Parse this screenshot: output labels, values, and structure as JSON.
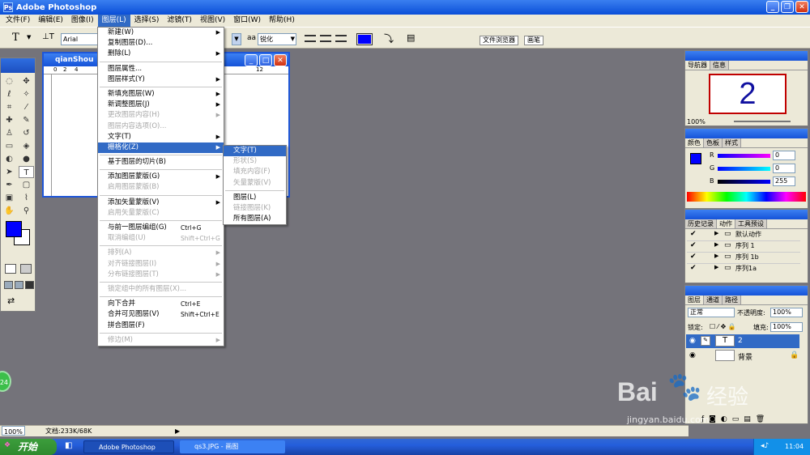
{
  "window": {
    "title": "Adobe Photoshop"
  },
  "menubar": [
    "文件(F)",
    "编辑(E)",
    "图像(I)",
    "图层(L)",
    "选择(S)",
    "滤镜(T)",
    "视图(V)",
    "窗口(W)",
    "帮助(H)"
  ],
  "options_bar": {
    "tool_glyph": "T",
    "font_family": "Arial",
    "aa_label": "aa",
    "antialias": "锐化",
    "tab_file_browser": "文件浏览器",
    "tab_brushes": "画笔"
  },
  "document": {
    "title": "qianShou",
    "ruler_labels": [
      "0",
      "2",
      "4",
      "12"
    ]
  },
  "layer_menu": {
    "items": [
      {
        "label": "新建(W)",
        "sub": true
      },
      {
        "label": "复制图层(D)..."
      },
      {
        "label": "删除(L)",
        "sub": true
      },
      {
        "sep": true
      },
      {
        "label": "图层属性..."
      },
      {
        "label": "图层样式(Y)",
        "sub": true
      },
      {
        "sep": true
      },
      {
        "label": "新填充图层(W)",
        "sub": true
      },
      {
        "label": "新调整图层(J)",
        "sub": true
      },
      {
        "label": "更改图层内容(H)",
        "sub": true,
        "dis": true
      },
      {
        "label": "图层内容选项(O)...",
        "dis": true
      },
      {
        "label": "文字(T)",
        "sub": true
      },
      {
        "label": "栅格化(Z)",
        "sub": true,
        "hi": true
      },
      {
        "sep": true
      },
      {
        "label": "基于图层的切片(B)"
      },
      {
        "sep": true
      },
      {
        "label": "添加图层蒙版(G)",
        "sub": true
      },
      {
        "label": "启用图层蒙版(B)",
        "dis": true
      },
      {
        "sep": true
      },
      {
        "label": "添加矢量蒙版(V)",
        "sub": true
      },
      {
        "label": "启用矢量蒙版(C)",
        "dis": true
      },
      {
        "sep": true
      },
      {
        "label": "与前一图层编组(G)",
        "shortcut": "Ctrl+G"
      },
      {
        "label": "取消编组(U)",
        "shortcut": "Shift+Ctrl+G",
        "dis": true
      },
      {
        "sep": true
      },
      {
        "label": "排列(A)",
        "sub": true,
        "dis": true
      },
      {
        "label": "对齐链接图层(I)",
        "sub": true,
        "dis": true
      },
      {
        "label": "分布链接图层(T)",
        "sub": true,
        "dis": true
      },
      {
        "sep": true
      },
      {
        "label": "锁定组中的所有图层(X)...",
        "dis": true
      },
      {
        "sep": true
      },
      {
        "label": "向下合并",
        "shortcut": "Ctrl+E"
      },
      {
        "label": "合并可见图层(V)",
        "shortcut": "Shift+Ctrl+E"
      },
      {
        "label": "拼合图层(F)"
      },
      {
        "sep": true
      },
      {
        "label": "修边(M)",
        "sub": true,
        "dis": true
      }
    ]
  },
  "rasterize_menu": {
    "items": [
      {
        "label": "文字(T)",
        "hi": true
      },
      {
        "label": "形状(S)",
        "dis": true
      },
      {
        "label": "填充内容(F)",
        "dis": true
      },
      {
        "label": "矢量蒙版(V)",
        "dis": true
      },
      {
        "sep": true
      },
      {
        "label": "图层(L)"
      },
      {
        "label": "链接图层(K)",
        "dis": true
      },
      {
        "label": "所有图层(A)"
      }
    ]
  },
  "navigator": {
    "tabs": [
      "导航器",
      "信息"
    ],
    "preview_text": "2",
    "zoom": "100%"
  },
  "color_panel": {
    "tabs": [
      "颜色",
      "色板",
      "样式"
    ],
    "r_label": "R",
    "g_label": "G",
    "b_label": "B",
    "r": "0",
    "g": "0",
    "b": "255",
    "fg": "#0000ff"
  },
  "history_panel": {
    "tabs": [
      "历史记录",
      "动作",
      "工具预设"
    ],
    "actions": [
      "默认动作",
      "序列 1",
      "序列 1b",
      "序列1a"
    ]
  },
  "layers_panel": {
    "tabs": [
      "图层",
      "通道",
      "路径"
    ],
    "blend": "正常",
    "opacity_label": "不透明度:",
    "opacity": "100%",
    "lock_label": "锁定:",
    "fill_label": "填充:",
    "fill": "100%",
    "layers": [
      {
        "name": "2",
        "type": "text"
      },
      {
        "name": "背景",
        "type": "bg"
      }
    ]
  },
  "status": {
    "zoom": "100%",
    "doc": "文档:233K/68K"
  },
  "taskbar": {
    "start": "开始",
    "tasks": [
      "Adobe Photoshop",
      "qs3.JPG - 画图"
    ],
    "clock": "11:04"
  },
  "watermark": {
    "brand": "Bai",
    "brand2": "经验",
    "url": "jingyan.baidu.com"
  },
  "badge": "24"
}
